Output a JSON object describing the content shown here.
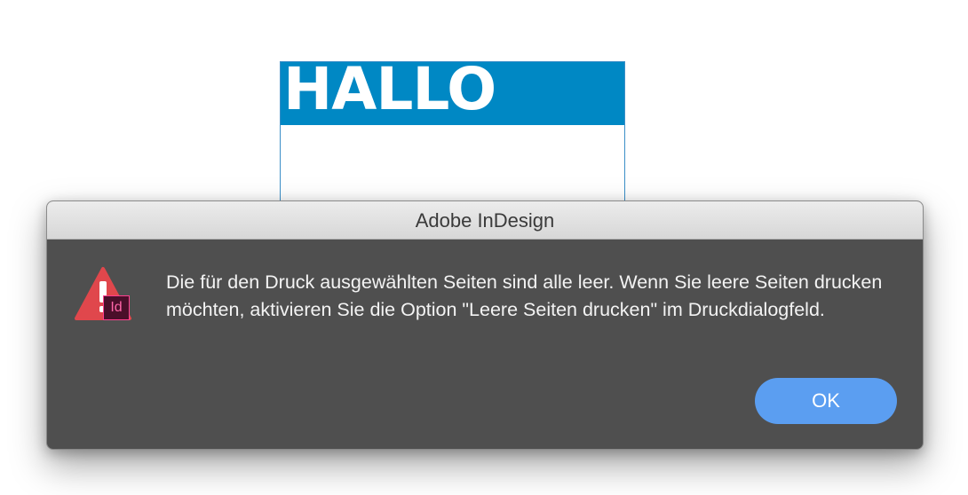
{
  "document": {
    "header_text": "HALLO",
    "header_color": "#0088c4"
  },
  "dialog": {
    "title": "Adobe InDesign",
    "icons": [
      "alert-triangle-icon",
      "indesign-app-icon"
    ],
    "app_badge": "Id",
    "message": "Die für den Druck ausgewählten Seiten sind alle leer. Wenn Sie leere Seiten drucken möchten, aktivieren Sie die Option \"Leere Seiten drucken\" im Druckdialogfeld.",
    "ok_label": "OK",
    "button_color": "#5b9ef1",
    "alert_color": "#e0474c"
  }
}
